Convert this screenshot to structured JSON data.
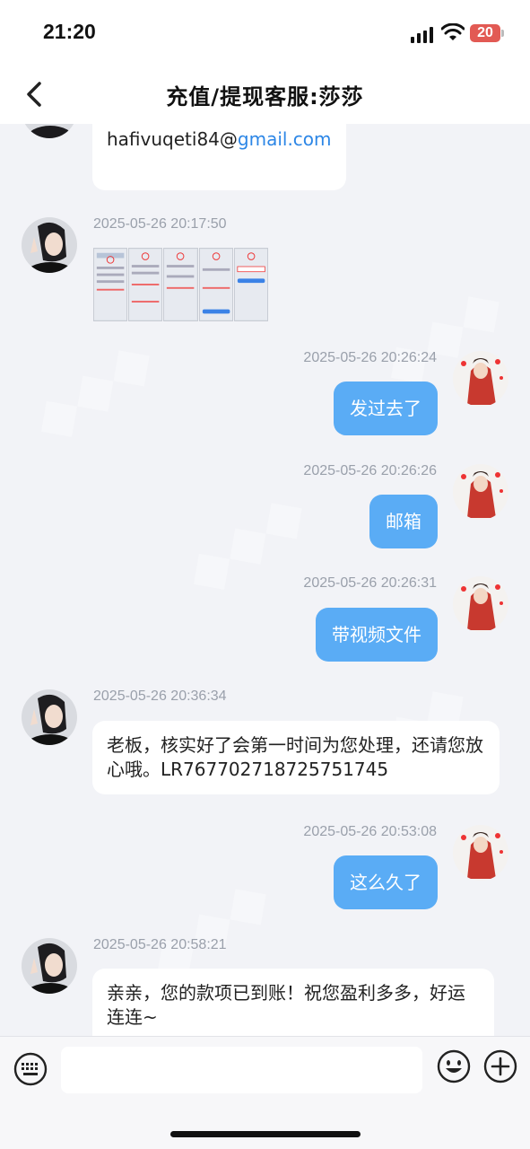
{
  "status_bar": {
    "time": "21:20",
    "battery": "20",
    "icons": [
      "signal-icon",
      "wifi-icon",
      "battery-icon"
    ]
  },
  "nav": {
    "title": "充值/提现客服:莎莎",
    "back_icon": "chevron-left-icon"
  },
  "colors": {
    "outgoing_bubble": "#5aacf5",
    "incoming_bubble": "#ffffff",
    "background": "#f2f3f7",
    "link": "#2c86e6",
    "battery": "#e25a54"
  },
  "messages": [
    {
      "id": "m0",
      "direction": "incoming",
      "type": "text",
      "email_user": "hafivuqeti84@",
      "email_domain": "gmail.com"
    },
    {
      "id": "m1",
      "direction": "incoming",
      "type": "image",
      "timestamp": "2025-05-26 20:17:50"
    },
    {
      "id": "m2",
      "direction": "outgoing",
      "type": "text",
      "timestamp": "2025-05-26 20:26:24",
      "text": "发过去了"
    },
    {
      "id": "m3",
      "direction": "outgoing",
      "type": "text",
      "timestamp": "2025-05-26 20:26:26",
      "text": "邮箱"
    },
    {
      "id": "m4",
      "direction": "outgoing",
      "type": "text",
      "timestamp": "2025-05-26 20:26:31",
      "text": "带视频文件"
    },
    {
      "id": "m5",
      "direction": "incoming",
      "type": "text",
      "timestamp": "2025-05-26 20:36:34",
      "text": " 老板，核实好了会第一时间为您处理，还请您放心哦。LR767702718725751745"
    },
    {
      "id": "m6",
      "direction": "outgoing",
      "type": "text",
      "timestamp": "2025-05-26 20:53:08",
      "text": "这么久了"
    },
    {
      "id": "m7",
      "direction": "incoming",
      "type": "text",
      "timestamp": "2025-05-26 20:58:21",
      "text": "亲亲，您的款项已到账！祝您盈利多多，好运连连~"
    }
  ],
  "input_bar": {
    "placeholder": "",
    "icons": [
      "keyboard-icon",
      "emoji-icon",
      "plus-icon"
    ]
  }
}
